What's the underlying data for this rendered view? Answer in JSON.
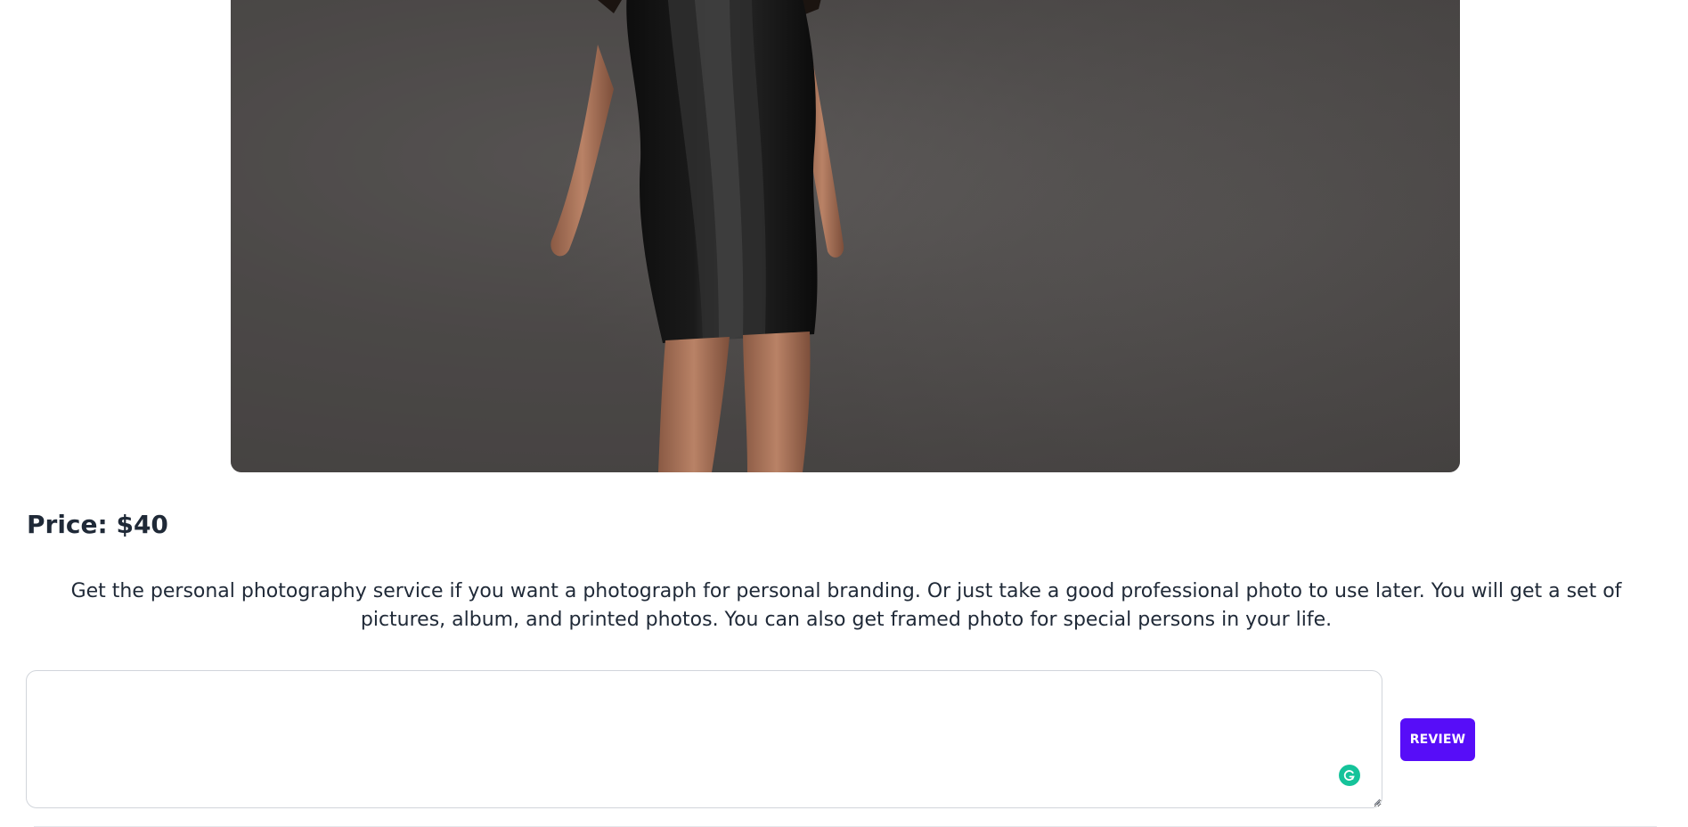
{
  "hero_image": {
    "alt_subject": "woman-in-black-leather-dress"
  },
  "service": {
    "price_label": "Price: $40",
    "description": "Get the personal photography service if you want a photograph for personal branding. Or just take a good professional photo to use later. You will get a set of pictures, album, and printed photos. You can also get framed photo for special persons in your life."
  },
  "review": {
    "textarea_value": "",
    "textarea_placeholder": "",
    "button_label": "REVIEW",
    "grammar_icon": "grammarly-icon"
  },
  "colors": {
    "accent": "#570df8",
    "text": "#1f2937",
    "grammar_badge": "#15c39a"
  }
}
